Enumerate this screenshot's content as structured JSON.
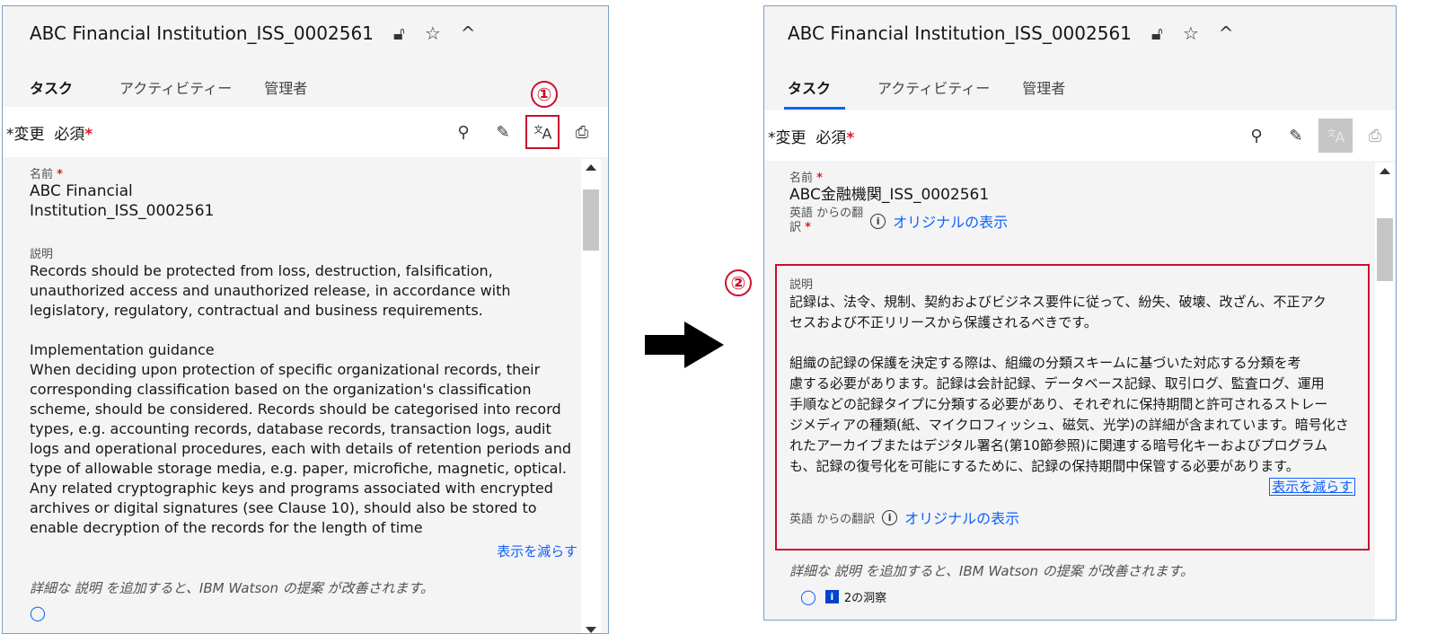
{
  "record_title": "ABC Financial Institution_ISS_0002561",
  "tabs": [
    "タスク",
    "アクティビティー",
    "管理者"
  ],
  "toolbar": {
    "change_prefix": "*変更",
    "required": "必須",
    "star": "*"
  },
  "step_badges": {
    "one": "①",
    "two": "②"
  },
  "left": {
    "name_label": "名前",
    "name_value_line1": "ABC Financial",
    "name_value_line2": "Institution_ISS_0002561",
    "desc_label": "説明",
    "desc_lines": [
      "Records should be protected from loss, destruction, falsification,",
      "unauthorized access and unauthorized release, in accordance with",
      "legislatory, regulatory, contractual and business requirements."
    ],
    "impl_lines": [
      "Implementation guidance",
      "When deciding upon protection of specific organizational records, their",
      "corresponding classification based on the organization's classification",
      "scheme, should be considered. Records should be categorised into record",
      "types, e.g. accounting records, database records, transaction logs, audit",
      "logs and operational procedures, each with details of retention periods and",
      "type of allowable storage media, e.g. paper, microfiche, magnetic, optical.",
      "Any related cryptographic keys and programs associated with encrypted",
      "archives or digital signatures (see Clause 10), should also be stored to",
      "enable decryption of the records for the length of time"
    ],
    "show_less": "表示を減らす",
    "hint": "詳細な 説明 を追加すると、IBM Watson の提案 が改善されます。"
  },
  "right": {
    "name_label": "名前",
    "name_value": "ABC金融機関_ISS_0002561",
    "trans_note_line1": "英語 からの翻",
    "trans_note_line2": "訳",
    "show_original": "オリジナルの表示",
    "desc_label": "説明",
    "para1": [
      "記録は、法令、規制、契約およびビジネス要件に従って、紛失、破壊、改ざん、不正アク",
      "セスおよび不正リリースから保護されるべきです。"
    ],
    "para2": [
      "組織の記録の保護を決定する際は、組織の分類スキームに基づいた対応する分類を考",
      "慮する必要があります。記録は会計記録、データベース記録、取引ログ、監査ログ、運用",
      "手順などの記録タイプに分類する必要があり、それぞれに保持期間と許可されるストレー",
      "ジメディアの種類(紙、マイクロフィッシュ、磁気、光学)の詳細が含まれています。暗号化さ",
      "れたアーカイブまたはデジタル署名(第10節参照)に関連する暗号化キーおよびプログラム",
      "も、記録の復号化を可能にするために、記録の保持期間中保管する必要があります。"
    ],
    "show_less": "表示を減らす",
    "trans_footer": "英語 からの翻訳",
    "hint": "詳細な 説明 を追加すると、IBM Watson の提案 が改善されます。",
    "insights": "2の洞察"
  },
  "colors": {
    "accent": "#0f62fe",
    "highlight": "#c8102e",
    "required": "#da1e28"
  }
}
